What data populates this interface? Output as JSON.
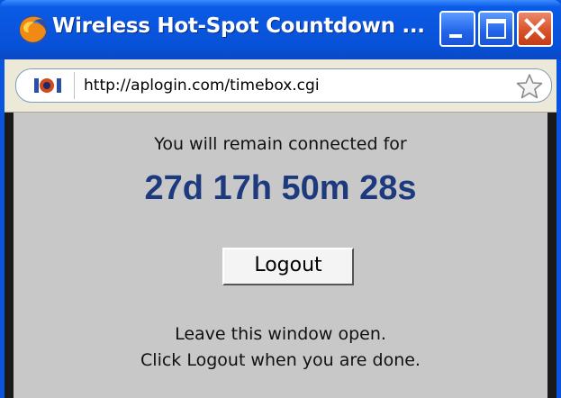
{
  "window": {
    "title": "Wireless Hot-Spot Countdown ...",
    "controls": {
      "minimize": "minimize",
      "maximize": "maximize",
      "close": "close"
    }
  },
  "addressbar": {
    "url": "http://aplogin.com/timebox.cgi",
    "site_icon": "site-identity-icon",
    "bookmark_icon": "star-icon"
  },
  "content": {
    "message_top": "You will remain connected for",
    "countdown": "27d 17h 50m 28s",
    "logout_label": "Logout",
    "message_line1": "Leave this window open.",
    "message_line2": "Click Logout when you are done."
  },
  "colors": {
    "titlebar": "#0a55de",
    "content_bg": "#c8c8c8",
    "countdown": "#1d3a7e"
  }
}
